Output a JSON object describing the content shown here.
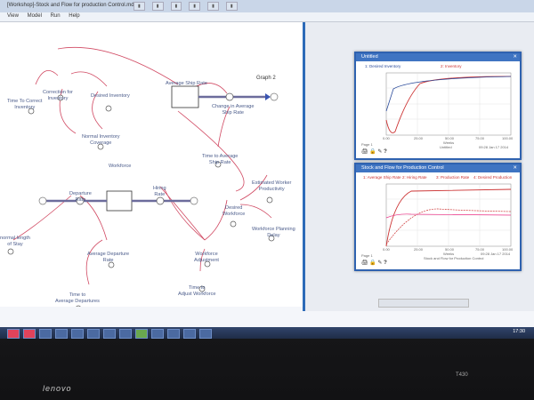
{
  "window": {
    "title": "[Workshop]-Stock and Flow for production Control.mdl"
  },
  "menubar": {
    "items": [
      "View",
      "Model",
      "Run",
      "Help"
    ]
  },
  "model": {
    "graph_label": "Graph 2",
    "variables": {
      "time_to_correct_inventory": "Time To Correct\nInventory",
      "correction_for_inventory": "Correction for\nInventory",
      "desired_inventory": "Desired Inventory",
      "average_ship_rate": "Average Ship Rate",
      "change_in_average_ship_rate": "Change in Average\nShip Rate",
      "normal_inventory_coverage": "Normal Inventory\nCoverage",
      "time_to_average_ship_rate": "Time to Average\nShip Rate",
      "workforce": "Workforce",
      "departure_rate": "Departure\nRate",
      "hiring_rate": "Hiring\nRate",
      "estimated_worker_productivity": "Estimated Worker\nProductivity",
      "desired_workforce": "Desired\nWorkforce",
      "workforce_planning_delay": "Workforce Planning\nDelay",
      "normal_length_of_stay": "normal length\nof Stay",
      "average_departure_rate": "Average Departure\nRate",
      "workforce_adjustment": "Workforce\nAdjustment",
      "time_to_average_departures": "Time to\nAverage Departures",
      "time_to_adjust_workforce": "Time to\nAdjust Workforce"
    }
  },
  "graph_window_1": {
    "title": "Untitled",
    "legend": [
      "1: Desired Inventory",
      "2: Inventory"
    ],
    "x_ticks": [
      "0.00",
      "25.00",
      "50.00",
      "75.00",
      "100.00"
    ],
    "x_label": "Weeks",
    "status": "Untitled",
    "timestamp": "09:28  Jan 17 2014",
    "page": "Page 1"
  },
  "graph_window_2": {
    "title": "Stock and Flow for Production Control",
    "legend": [
      "1: Average Ship Rate",
      "2: Hiring Rate",
      "3: Production Rate",
      "4: Desired Production"
    ],
    "x_ticks": [
      "0.00",
      "25.00",
      "50.00",
      "75.00",
      "100.00"
    ],
    "x_label": "Weeks",
    "status": "Stock and Flow for Production Control",
    "timestamp": "09:28  Jan 17 2014",
    "page": "Page 1"
  },
  "taskbar": {
    "clock": "17:30"
  },
  "laptop": {
    "brand": "lenovo",
    "model": "T430"
  },
  "colors": {
    "accent": "#2f62b0",
    "link": "#d14a63",
    "var": "#4a5b8a"
  }
}
